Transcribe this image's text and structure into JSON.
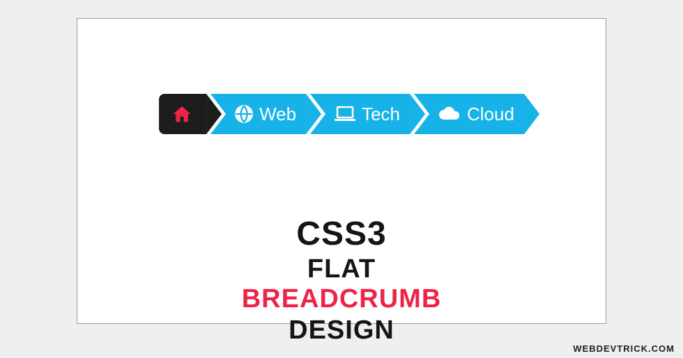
{
  "colors": {
    "page_bg": "#efefef",
    "frame_bg": "#ffffff",
    "frame_border": "#999999",
    "breadcrumb_home_bg": "#1d1d1d",
    "breadcrumb_home_icon": "#ed2448",
    "breadcrumb_blue": "#16b2e8",
    "breadcrumb_text": "#ffffff",
    "headline_dark": "#151515",
    "headline_accent": "#ed2448"
  },
  "breadcrumb": {
    "items": [
      {
        "icon": "home-icon",
        "label": ""
      },
      {
        "icon": "globe-icon",
        "label": "Web"
      },
      {
        "icon": "laptop-icon",
        "label": "Tech"
      },
      {
        "icon": "cloud-icon",
        "label": "Cloud"
      }
    ]
  },
  "headline": {
    "line1": "CSS3",
    "line2_word1": "FLAT",
    "line2_word2": "BREADCRUMB",
    "line3": "DESIGN"
  },
  "footer": {
    "credit": "WEBDEVTRICK.COM"
  }
}
